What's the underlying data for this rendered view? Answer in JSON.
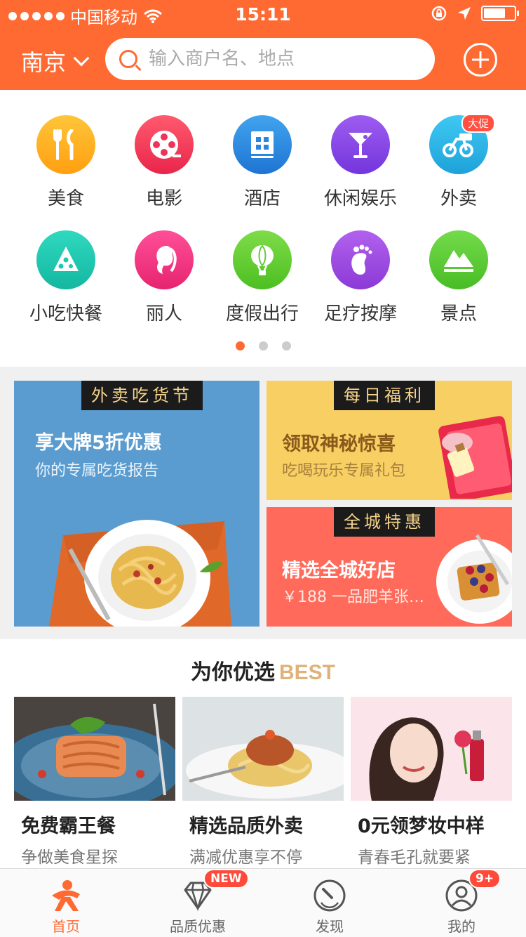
{
  "status": {
    "carrier": "中国移动",
    "time": "15:11"
  },
  "header": {
    "city": "南京",
    "search_placeholder": "输入商户名、地点"
  },
  "categories": [
    {
      "label": "美食",
      "icon": "fork-knife-icon",
      "color": "#ffb21f"
    },
    {
      "label": "电影",
      "icon": "film-reel-icon",
      "color": "#f53b5a"
    },
    {
      "label": "酒店",
      "icon": "building-icon",
      "color": "#2f8be0"
    },
    {
      "label": "休闲娱乐",
      "icon": "cocktail-icon",
      "color": "#8a4de8"
    },
    {
      "label": "外卖",
      "icon": "scooter-icon",
      "color": "#2bb6e6",
      "tag": "大促"
    },
    {
      "label": "小吃快餐",
      "icon": "pizza-slice-icon",
      "color": "#1ec9b1"
    },
    {
      "label": "丽人",
      "icon": "woman-profile-icon",
      "color": "#f43a86"
    },
    {
      "label": "度假出行",
      "icon": "hot-air-balloon-icon",
      "color": "#6cd03a"
    },
    {
      "label": "足疗按摩",
      "icon": "foot-icon",
      "color": "#a34fe0"
    },
    {
      "label": "景点",
      "icon": "mountain-icon",
      "color": "#61cc3c"
    }
  ],
  "promos": {
    "takeout": {
      "badge": "外卖吃货节",
      "title": "享大牌5折优惠",
      "sub": "你的专属吃货报告"
    },
    "daily": {
      "badge": "每日福利",
      "title": "领取神秘惊喜",
      "sub": "吃喝玩乐专属礼包"
    },
    "city": {
      "badge": "全城特惠",
      "title": "精选全城好店",
      "sub": "￥188 一品肥羊张…"
    }
  },
  "best": {
    "title": "为你优选",
    "title_en": "BEST",
    "items": [
      {
        "title": "免费霸王餐",
        "sub": "争做美食星探"
      },
      {
        "title": "精选品质外卖",
        "sub": "满减优惠享不停"
      },
      {
        "title": "0元领梦妆中样",
        "sub": "青春毛孔就要紧"
      }
    ]
  },
  "tabs": [
    {
      "label": "首页",
      "active": true
    },
    {
      "label": "品质优惠",
      "badge": "NEW"
    },
    {
      "label": "发现"
    },
    {
      "label": "我的",
      "badge": "9+"
    }
  ]
}
